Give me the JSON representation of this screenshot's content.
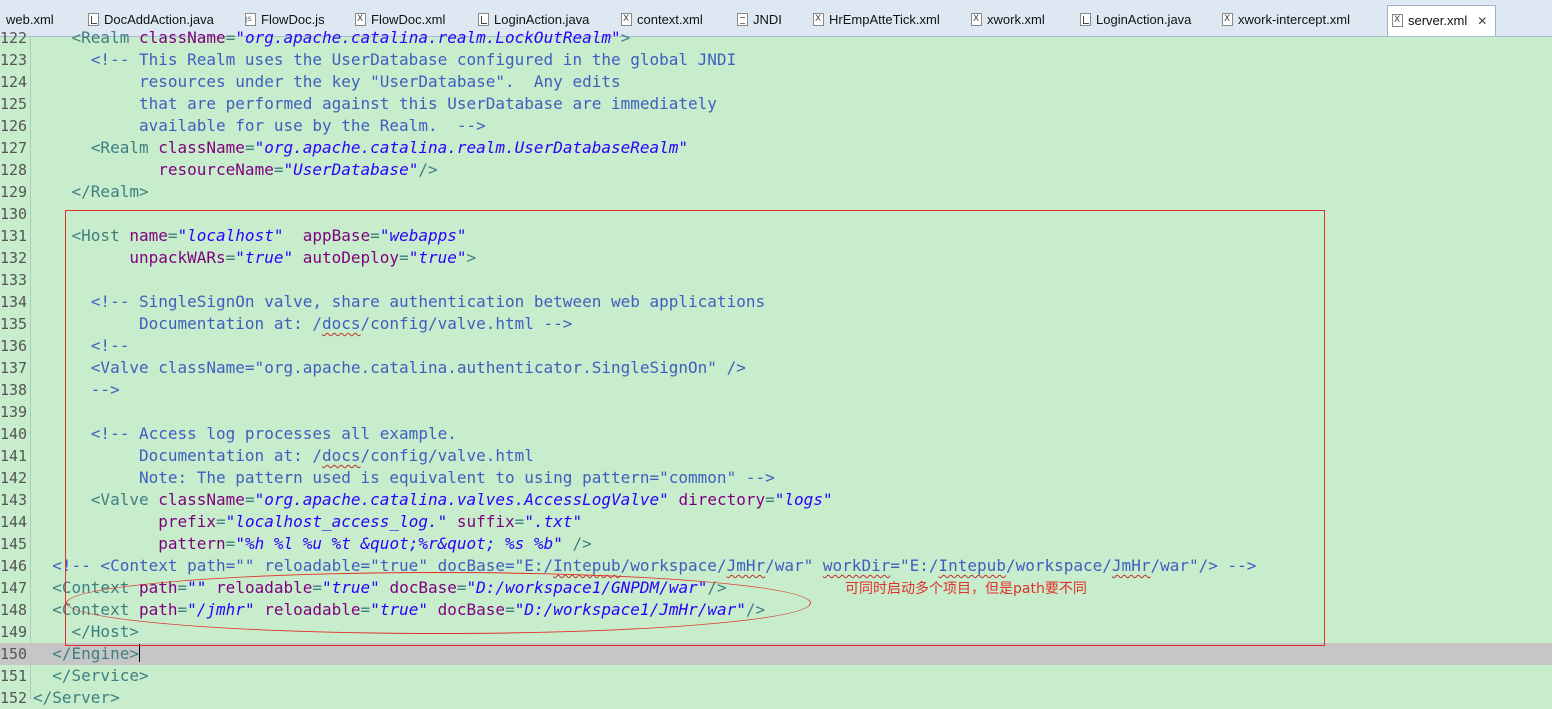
{
  "tabs": [
    {
      "label": "web.xml",
      "icon": "xml"
    },
    {
      "label": "DocAddAction.java",
      "icon": "java"
    },
    {
      "label": "FlowDoc.js",
      "icon": "js"
    },
    {
      "label": "FlowDoc.xml",
      "icon": "xml"
    },
    {
      "label": "LoginAction.java",
      "icon": "java"
    },
    {
      "label": "context.xml",
      "icon": "xml"
    },
    {
      "label": "JNDI",
      "icon": "doc"
    },
    {
      "label": "HrEmpAtteTick.xml",
      "icon": "xml"
    },
    {
      "label": "xwork.xml",
      "icon": "xml"
    },
    {
      "label": "LoginAction.java",
      "icon": "java"
    },
    {
      "label": "xwork-intercept.xml",
      "icon": "xml"
    },
    {
      "label": "server.xml",
      "icon": "xml",
      "active": true
    }
  ],
  "close_glyph": "✕",
  "annotation_note": "可同时启动多个项目，但是path要不同",
  "lines": [
    {
      "n": "122",
      "s": [
        [
          "t",
          "    <Realm "
        ],
        [
          "a",
          "className"
        ],
        [
          "t",
          "="
        ],
        [
          "v",
          "\"org.apache.catalina.realm.LockOutRealm\""
        ],
        [
          "t",
          ">"
        ]
      ]
    },
    {
      "n": "123",
      "s": [
        [
          "c",
          "      <!-- This Realm uses the UserDatabase configured in the global JNDI"
        ]
      ]
    },
    {
      "n": "124",
      "s": [
        [
          "c",
          "           resources under the key \"UserDatabase\".  Any edits"
        ]
      ]
    },
    {
      "n": "125",
      "s": [
        [
          "c",
          "           that are performed against this UserDatabase are immediately"
        ]
      ]
    },
    {
      "n": "126",
      "s": [
        [
          "c",
          "           available for use by the Realm.  -->"
        ]
      ]
    },
    {
      "n": "127",
      "s": [
        [
          "t",
          "      <Realm "
        ],
        [
          "a",
          "className"
        ],
        [
          "t",
          "="
        ],
        [
          "v",
          "\"org.apache.catalina.realm.UserDatabaseRealm\""
        ]
      ]
    },
    {
      "n": "128",
      "s": [
        [
          "t",
          "             "
        ],
        [
          "a",
          "resourceName"
        ],
        [
          "t",
          "="
        ],
        [
          "v",
          "\"UserDatabase\""
        ],
        [
          "t",
          "/>"
        ]
      ]
    },
    {
      "n": "129",
      "s": [
        [
          "t",
          "    </Realm>"
        ]
      ]
    },
    {
      "n": "130",
      "s": []
    },
    {
      "n": "131",
      "s": [
        [
          "t",
          "    <Host "
        ],
        [
          "a",
          "name"
        ],
        [
          "t",
          "="
        ],
        [
          "v",
          "\"localhost\""
        ],
        [
          "t",
          "  "
        ],
        [
          "a",
          "appBase"
        ],
        [
          "t",
          "="
        ],
        [
          "v",
          "\"webapps\""
        ]
      ]
    },
    {
      "n": "132",
      "s": [
        [
          "t",
          "          "
        ],
        [
          "a",
          "unpackWARs"
        ],
        [
          "t",
          "="
        ],
        [
          "v",
          "\"true\""
        ],
        [
          "t",
          " "
        ],
        [
          "a",
          "autoDeploy"
        ],
        [
          "t",
          "="
        ],
        [
          "v",
          "\"true\""
        ],
        [
          "t",
          ">"
        ]
      ]
    },
    {
      "n": "133",
      "s": []
    },
    {
      "n": "134",
      "s": [
        [
          "c",
          "      <!-- SingleSignOn valve, share authentication between web applications"
        ]
      ]
    },
    {
      "n": "135",
      "s": [
        [
          "c",
          "           Documentation at: /"
        ],
        [
          "cu",
          "docs"
        ],
        [
          "c",
          "/config/valve.html -->"
        ]
      ]
    },
    {
      "n": "136",
      "s": [
        [
          "c",
          "      <!--"
        ]
      ]
    },
    {
      "n": "137",
      "s": [
        [
          "c",
          "      <Valve className=\"org.apache.catalina.authenticator.SingleSignOn\" />"
        ]
      ]
    },
    {
      "n": "138",
      "s": [
        [
          "c",
          "      -->"
        ]
      ]
    },
    {
      "n": "139",
      "s": []
    },
    {
      "n": "140",
      "s": [
        [
          "c",
          "      <!-- Access log processes all example."
        ]
      ]
    },
    {
      "n": "141",
      "s": [
        [
          "c",
          "           Documentation at: /"
        ],
        [
          "cu",
          "docs"
        ],
        [
          "c",
          "/config/valve.html"
        ]
      ]
    },
    {
      "n": "142",
      "s": [
        [
          "c",
          "           Note: The pattern used is equivalent to using pattern=\"common\" -->"
        ]
      ]
    },
    {
      "n": "143",
      "s": [
        [
          "t",
          "      <Valve "
        ],
        [
          "a",
          "className"
        ],
        [
          "t",
          "="
        ],
        [
          "v",
          "\"org.apache.catalina.valves.AccessLogValve\""
        ],
        [
          "t",
          " "
        ],
        [
          "a",
          "directory"
        ],
        [
          "t",
          "="
        ],
        [
          "v",
          "\"logs\""
        ]
      ]
    },
    {
      "n": "144",
      "s": [
        [
          "t",
          "             "
        ],
        [
          "a",
          "prefix"
        ],
        [
          "t",
          "="
        ],
        [
          "v",
          "\"localhost_access_log.\""
        ],
        [
          "t",
          " "
        ],
        [
          "a",
          "suffix"
        ],
        [
          "t",
          "="
        ],
        [
          "v",
          "\".txt\""
        ]
      ]
    },
    {
      "n": "145",
      "s": [
        [
          "t",
          "             "
        ],
        [
          "a",
          "pattern"
        ],
        [
          "t",
          "="
        ],
        [
          "v",
          "\"%h %l %u %t &quot;%r&quot; %s %b\""
        ],
        [
          "t",
          " />"
        ]
      ]
    },
    {
      "n": "146",
      "s": [
        [
          "c",
          "  <!-- <Context path=\"\" reloadable=\"true\" docBase=\"E:/"
        ],
        [
          "cu",
          "Intepub"
        ],
        [
          "c",
          "/workspace/"
        ],
        [
          "cu",
          "JmHr"
        ],
        [
          "c",
          "/war\" "
        ],
        [
          "cu",
          "workDir"
        ],
        [
          "c",
          "=\"E:/"
        ],
        [
          "cu",
          "Intepub"
        ],
        [
          "c",
          "/workspace/"
        ],
        [
          "cu",
          "JmHr"
        ],
        [
          "c",
          "/war\"/> -->"
        ]
      ]
    },
    {
      "n": "147",
      "s": [
        [
          "t",
          "  <Context "
        ],
        [
          "a",
          "path"
        ],
        [
          "t",
          "="
        ],
        [
          "v",
          "\"\""
        ],
        [
          "t",
          " "
        ],
        [
          "a",
          "reloadable"
        ],
        [
          "t",
          "="
        ],
        [
          "v",
          "\"true\""
        ],
        [
          "t",
          " "
        ],
        [
          "a",
          "docBase"
        ],
        [
          "t",
          "="
        ],
        [
          "v",
          "\"D:/workspace1/GNPDM/war\""
        ],
        [
          "t",
          "/>"
        ]
      ]
    },
    {
      "n": "148",
      "s": [
        [
          "t",
          "  <Context "
        ],
        [
          "a",
          "path"
        ],
        [
          "t",
          "="
        ],
        [
          "v",
          "\"/jmhr\""
        ],
        [
          "t",
          " "
        ],
        [
          "a",
          "reloadable"
        ],
        [
          "t",
          "="
        ],
        [
          "v",
          "\"true\""
        ],
        [
          "t",
          " "
        ],
        [
          "a",
          "docBase"
        ],
        [
          "t",
          "="
        ],
        [
          "v",
          "\"D:/workspace1/JmHr/war\""
        ],
        [
          "t",
          "/>"
        ]
      ]
    },
    {
      "n": "149",
      "s": [
        [
          "t",
          "    </Host>"
        ]
      ]
    },
    {
      "n": "150",
      "s": [
        [
          "t",
          "  </Engine>"
        ]
      ],
      "current": true
    },
    {
      "n": "151",
      "s": [
        [
          "t",
          "  </Service>"
        ]
      ]
    },
    {
      "n": "152",
      "s": [
        [
          "t",
          "</Server>"
        ]
      ]
    }
  ]
}
